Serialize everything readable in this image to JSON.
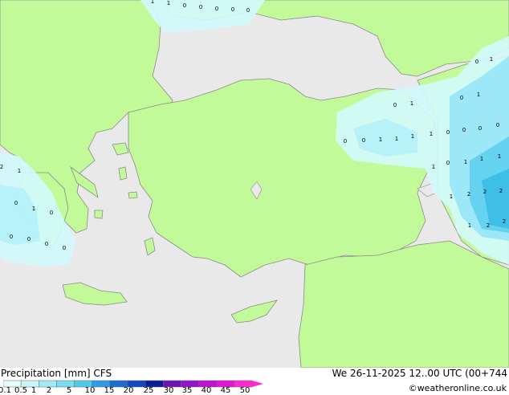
{
  "colors": {
    "sea": "#e9e9e9",
    "land": "#c2fa99",
    "coast": "#8a8a8a",
    "precip_0_1": "#d2fafc",
    "precip_0_5": "#b4f0fa",
    "precip_1": "#96e6f8",
    "precip_2": "#5fd0ee",
    "precip_5": "#39bde6"
  },
  "map": {
    "values": [
      "1",
      "1",
      "0",
      "0",
      "0",
      "0",
      "0",
      "0",
      "1",
      "0",
      "1",
      "1",
      "0",
      "0",
      "0",
      "0",
      "1",
      "1",
      "1",
      "1",
      "0",
      "0",
      "0",
      "1",
      "0",
      "1",
      "1",
      "1",
      "2",
      "1",
      "2",
      "2",
      "1",
      "2",
      "2",
      "3",
      "0",
      "1",
      "2",
      "1",
      "0",
      "1",
      "0",
      "0",
      "0",
      "0",
      "0"
    ]
  },
  "legend": {
    "title": "Precipitation [mm]  CFS",
    "ticks": [
      "0.1",
      "0.5",
      "1",
      "2",
      "5",
      "10",
      "15",
      "20",
      "25",
      "30",
      "35",
      "40",
      "45",
      "50"
    ],
    "colors": [
      "#e6fcfc",
      "#c8f5fa",
      "#a0ebf8",
      "#7adcf2",
      "#50c8ea",
      "#2d9be6",
      "#1e6ed2",
      "#1446be",
      "#0a1e96",
      "#6e14b4",
      "#9614c8",
      "#be14d2",
      "#e614d2",
      "#ff28d2"
    ]
  },
  "validity": "We 26-11-2025 12..00 UTC (00+744",
  "credit": "©weatheronline.co.uk"
}
